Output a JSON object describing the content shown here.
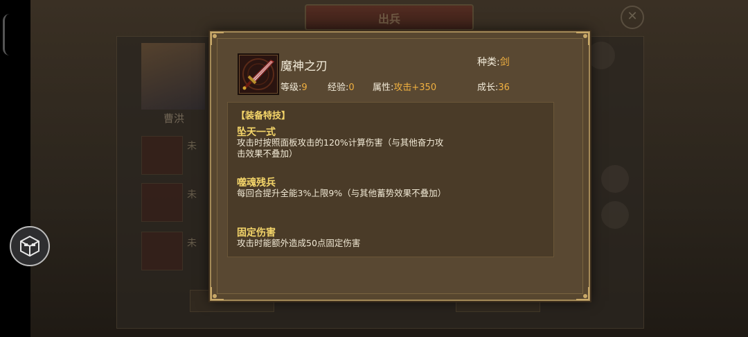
{
  "background": {
    "title": "出兵",
    "hero_name": "曹洪",
    "slot_label": "未",
    "close_glyph": "✕"
  },
  "item": {
    "name": "魔神之刃",
    "kind_label": "种类:",
    "kind_value": "剑",
    "level_label": "等级:",
    "level_value": "9",
    "exp_label": "经验:",
    "exp_value": "0",
    "attr_label": "属性:",
    "attr_value": "攻击+350",
    "growth_label": "成长:",
    "growth_value": "36",
    "icon": "sword-icon"
  },
  "skills": {
    "header": "【装备特技】",
    "list": [
      {
        "name": "坠天一式",
        "desc_line1": "攻击时按照面板攻击的120%计算伤害（与其他奋力攻",
        "desc_line2": "击效果不叠加）"
      },
      {
        "name": "噬魂残兵",
        "desc_line1": "每回合提升全能3%上限9%（与其他蓄势效果不叠加）",
        "desc_line2": ""
      },
      {
        "name": "固定伤害",
        "desc_line1": "攻击时能额外造成50点固定伤害",
        "desc_line2": ""
      }
    ]
  },
  "colors": {
    "accent_gold": "#f5d66a",
    "value_orange": "#f0b040",
    "panel_brown": "#57462f"
  }
}
